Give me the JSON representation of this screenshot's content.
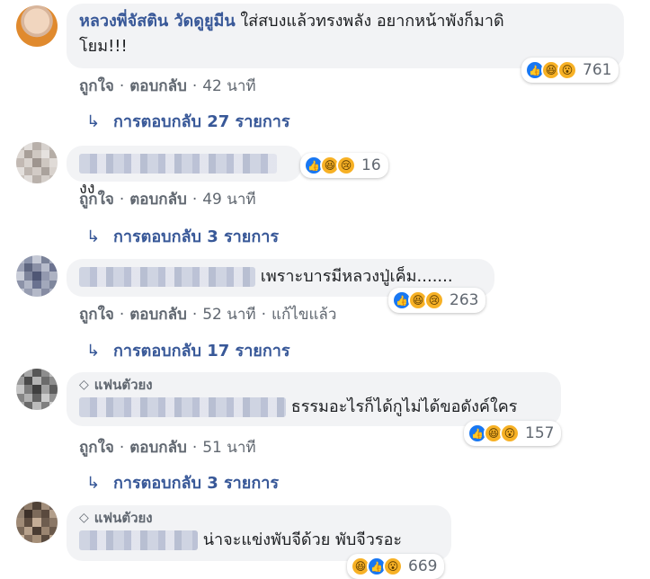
{
  "comments": [
    {
      "author": "หลวงพี่จัสติน วัดดูยูมีน",
      "text_line1": "ใส่สบงแล้วทรงพลัง อยากหน้าพังก็มาดิ",
      "text_line2": "โยม!!!",
      "like": "ถูกใจ",
      "reply": "ตอบกลับ",
      "time": "42 นาที",
      "reaction_count": "761",
      "replies_label": "การตอบกลับ 27 รายการ"
    },
    {
      "text": "งง",
      "like": "ถูกใจ",
      "reply": "ตอบกลับ",
      "time": "49 นาที",
      "reaction_count": "16",
      "replies_label": "การตอบกลับ 3 รายการ"
    },
    {
      "text": "เพราะบารมีหลวงปู่เค็ม.......",
      "like": "ถูกใจ",
      "reply": "ตอบกลับ",
      "time": "52 นาที",
      "edited": "แก้ไขแล้ว",
      "reaction_count": "263",
      "replies_label": "การตอบกลับ 17 รายการ"
    },
    {
      "badge": "แฟนตัวยง",
      "text": "ธรรมอะไรก็ได้กูไม่ได้ขอดังค์ใคร",
      "like": "ถูกใจ",
      "reply": "ตอบกลับ",
      "time": "51 นาที",
      "reaction_count": "157",
      "replies_label": "การตอบกลับ 3 รายการ"
    },
    {
      "badge": "แฟนตัวยง",
      "text": "น่าจะแข่งพับจีด้วย พับจีวรอะ",
      "reaction_count": "669"
    }
  ],
  "icons": {
    "reply_arrow": "reply-arrow-icon",
    "badge": "diamond-icon",
    "reactions": [
      "like-icon",
      "haha-icon",
      "wow-icon",
      "sad-icon"
    ]
  },
  "colors": {
    "link": "#385898",
    "bubble": "#f2f3f5",
    "meta": "#606770",
    "like": "#1877f2"
  }
}
